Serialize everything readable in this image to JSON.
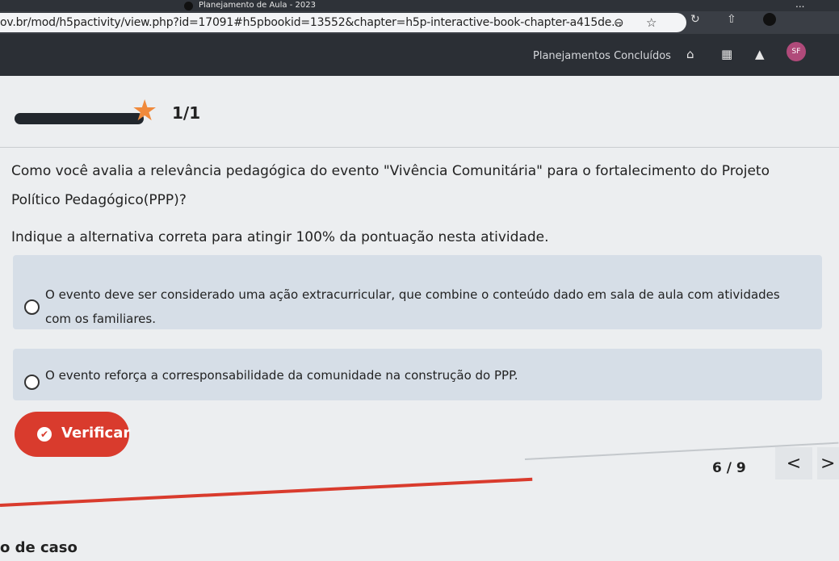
{
  "browser": {
    "tab_title": "Planejamento de Aula - 2023",
    "tab_more": "...",
    "url": "ov.br/mod/h5pactivity/view.php?id=17091#h5pbookid=13552&chapter=h5p-interactive-book-chapter-a415de...",
    "icons": [
      "tab-indicator-icon",
      "page-action-icon",
      "bookmark-star-icon",
      "reload-icon",
      "extensions-icon",
      "profile-icon"
    ]
  },
  "site": {
    "nav_label": "Planejamentos Concluídos",
    "user_initials": "SF",
    "icons": [
      "home-icon",
      "calendar-icon",
      "notification-bell-icon"
    ]
  },
  "progress": {
    "score": "1/1",
    "filled_fraction": 1.0,
    "star_color": "#f08a3c"
  },
  "question": {
    "text": "Como você avalia a relevância pedagógica do evento \"Vivência Comunitária\" para o fortalecimento do Projeto Político Pedagógico(PPP)?",
    "instruction": "Indique a alternativa correta para atingir 100% da pontuação nesta atividade.",
    "options": [
      {
        "text": "O evento deve ser considerado uma ação extracurricular, que combine o conteúdo dado em sala de aula com atividades com os familiares.",
        "selected": false
      },
      {
        "text": "O evento reforça a corresponsabilidade da comunidade na construção do PPP.",
        "selected": false
      }
    ]
  },
  "actions": {
    "verify_label": "Verificar",
    "accent_color": "#d93b2d"
  },
  "pagination": {
    "current": "6 / 9",
    "prev": "<",
    "next": ">"
  },
  "footer": {
    "partial_text": "o de caso"
  }
}
